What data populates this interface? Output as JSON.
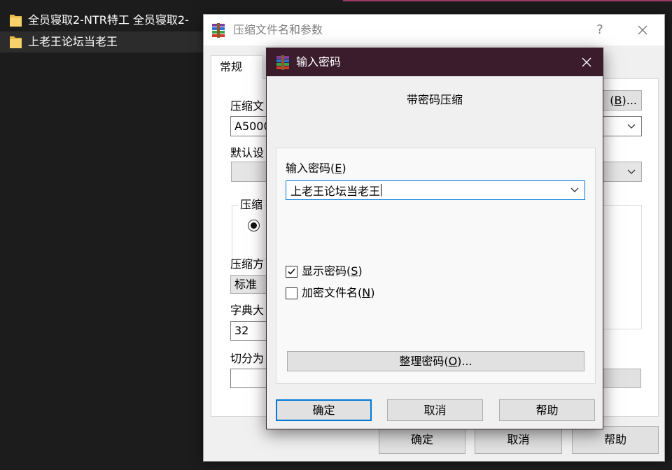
{
  "colors": {
    "accent": "#0078d7",
    "password_titlebar": "#3b1c2c",
    "folder": "#e8b648",
    "desktop_bg": "#1c1c1c"
  },
  "explorer": {
    "items": [
      {
        "label": "全员寝取2-NTR特工 全员寝取2-",
        "icon": "folder-icon",
        "selected": false
      },
      {
        "label": "上老王论坛当老王",
        "icon": "folder-icon",
        "selected": true
      }
    ]
  },
  "archive_dialog": {
    "icon": "winrar-icon",
    "title": "压缩文件名和参数",
    "help_label": "?",
    "tabs": [
      {
        "label": "常规",
        "active": true
      }
    ],
    "general": {
      "archive_name_label": "压缩文",
      "archive_name_value": "A5000",
      "browse_label": "(B)...",
      "profiles_label": "默认设",
      "format_group_label": "压缩",
      "method_label": "压缩方",
      "method_value": "标准",
      "dictionary_label": "字典大",
      "dictionary_value": "32",
      "split_label": "切分为"
    },
    "buttons": {
      "ok": "确定",
      "cancel": "取消",
      "help": "帮助"
    }
  },
  "password_dialog": {
    "icon": "winrar-icon",
    "title": "输入密码",
    "heading": "带密码压缩",
    "password_label": "输入密码(E)",
    "password_value": "上老王论坛当老王",
    "show_password": {
      "label": "显示密码(S)",
      "checked": true
    },
    "encrypt_names": {
      "label": "加密文件名(N)",
      "checked": false
    },
    "organize_label": "整理密码(O)...",
    "buttons": {
      "ok": "确定",
      "cancel": "取消",
      "help": "帮助"
    }
  }
}
